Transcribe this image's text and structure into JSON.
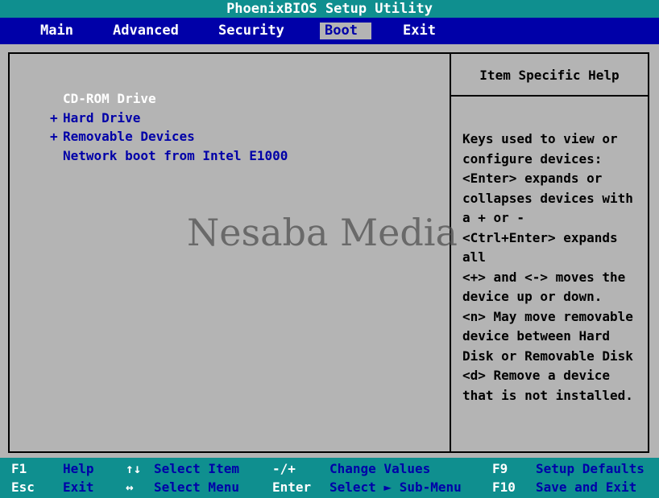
{
  "title": "PhoenixBIOS Setup Utility",
  "menu": [
    {
      "label": "Main"
    },
    {
      "label": "Advanced"
    },
    {
      "label": "Security"
    },
    {
      "label": "Boot"
    },
    {
      "label": "Exit"
    }
  ],
  "active_menu": "Boot",
  "boot_list": {
    "items": [
      {
        "label": "CD-ROM Drive",
        "prefix": ""
      },
      {
        "label": "Hard Drive",
        "prefix": "+"
      },
      {
        "label": "Removable Devices",
        "prefix": "+"
      },
      {
        "label": "Network boot from Intel E1000",
        "prefix": ""
      }
    ],
    "selected": "CD-ROM Drive"
  },
  "help": {
    "title": "Item Specific Help",
    "text": "Keys used to view or\nconfigure devices:\n<Enter> expands or\ncollapses devices with\na + or -\n<Ctrl+Enter> expands\nall\n<+> and <-> moves the\ndevice up or down.\n<n> May move removable\ndevice between Hard\nDisk or Removable Disk\n<d> Remove a device\nthat is not installed."
  },
  "watermark": "Nesaba Media",
  "footer": {
    "row1": [
      {
        "key": "F1",
        "desc": "Help"
      },
      {
        "key": "↑↓",
        "desc": "Select Item"
      },
      {
        "key": "-/+",
        "desc": "Change Values"
      },
      {
        "key": "F9",
        "desc": "Setup Defaults"
      }
    ],
    "row2": [
      {
        "key": "Esc",
        "desc": "Exit"
      },
      {
        "key": "↔",
        "desc": "Select Menu"
      },
      {
        "key": "Enter",
        "desc": "Select ► Sub-Menu"
      },
      {
        "key": "F10",
        "desc": "Save and Exit"
      }
    ]
  },
  "colors": {
    "title_bg": "#0f8f8f",
    "menu_bg": "#0000a8",
    "body_bg": "#b4b4b4",
    "selected_text": "#ffffff",
    "item_text": "#0000a8"
  }
}
